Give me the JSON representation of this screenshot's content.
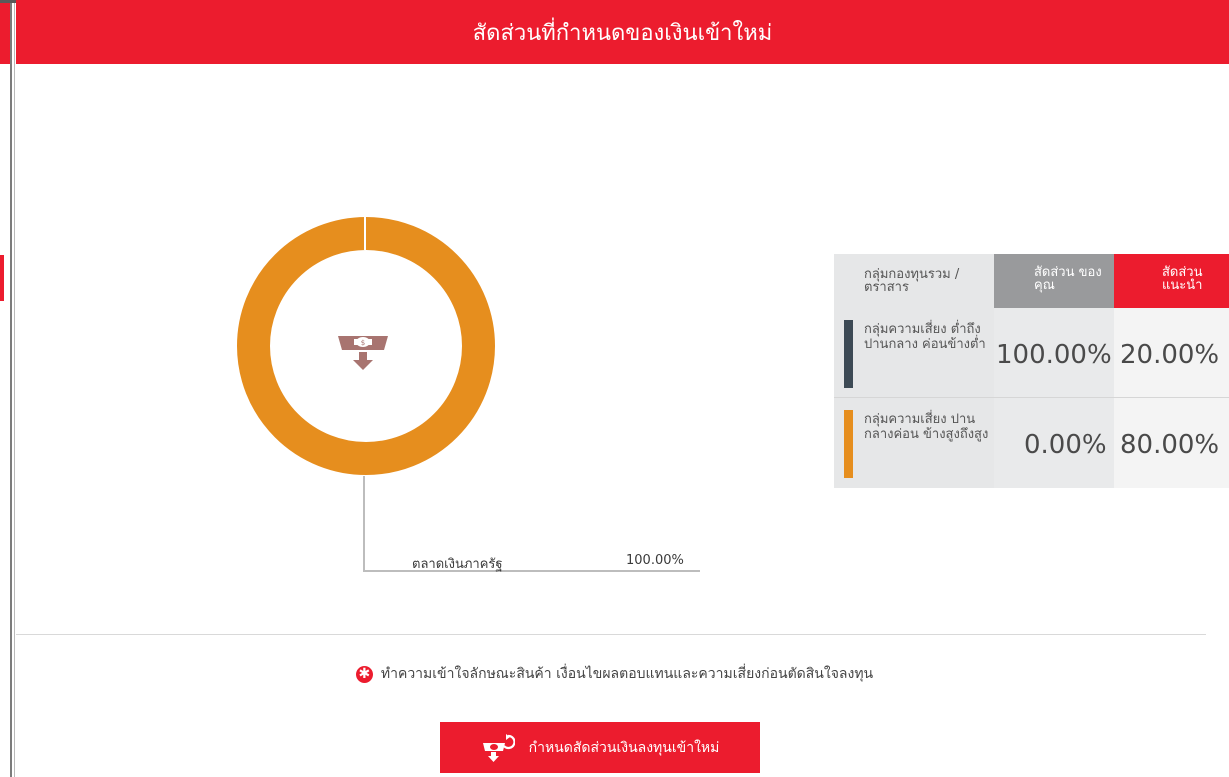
{
  "header": {
    "title": "สัดส่วนที่กำหนดของเงินเข้าใหม่"
  },
  "chart_data": {
    "type": "pie",
    "categories": [
      "ตลาดเงินภาครัฐ"
    ],
    "values": [
      100.0
    ],
    "colors": [
      "#e68e1e"
    ],
    "value_labels": [
      "100.00%"
    ],
    "center_icon": "money-drawer-icon"
  },
  "legend": {
    "label": "ตลาดเงินภาครัฐ",
    "value": "100.00%"
  },
  "table": {
    "headers": {
      "group": "กลุ่มกองทุนรวม / ตราสาร",
      "yours": "สัดส่วน ของคุณ",
      "recommended": "สัดส่วน แนะนำ"
    },
    "rows": [
      {
        "group": "กลุ่มความเสี่ยง ต่ำถึงปานกลาง ค่อนข้างต่ำ",
        "yours": "100.00%",
        "recommended": "20.00%",
        "color": "#3d4a55"
      },
      {
        "group": "กลุ่มความเสี่ยง ปานกลางค่อน ข้างสูงถึงสูง",
        "yours": "0.00%",
        "recommended": "80.00%",
        "color": "#e68e1e"
      }
    ]
  },
  "disclaimer": {
    "icon": "asterisk-icon",
    "text": "ทำความเข้าใจลักษณะสินค้า เงื่อนไขผลตอบแทนและความเสี่ยงก่อนตัดสินใจลงทุน"
  },
  "cta": {
    "label": "กำหนดสัดส่วนเงินลงทุนเข้าใหม่",
    "icon": "money-refresh-icon"
  },
  "colors": {
    "accent": "#ec1c2e",
    "orange": "#e68e1e",
    "dark_slate": "#3d4a55",
    "icon_brown": "#a87470"
  }
}
